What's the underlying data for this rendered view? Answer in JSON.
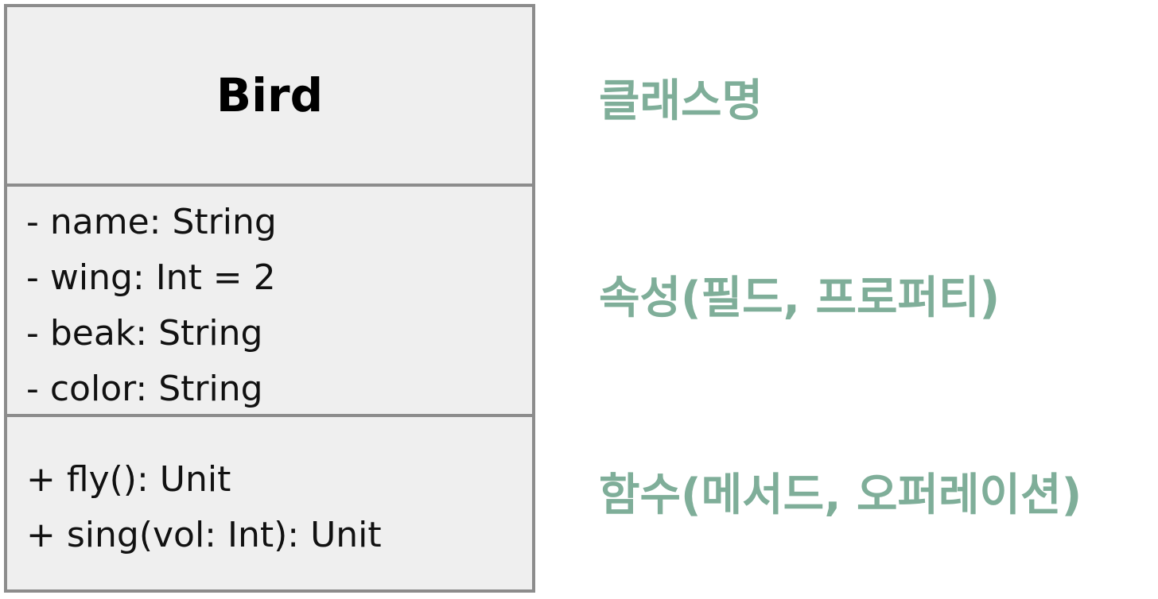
{
  "uml_class": {
    "name": "Bird",
    "attributes": [
      "- name: String",
      "- wing: Int = 2",
      "- beak: String",
      "- color: String"
    ],
    "methods": [
      "+ fly(): Unit",
      "+ sing(vol: Int): Unit"
    ]
  },
  "labels": {
    "class_name": "클래스명",
    "attributes": "속성(필드, 프로퍼티)",
    "methods": "함수(메서드, 오퍼레이션)"
  },
  "colors": {
    "label": "#7fae99",
    "box_border": "#8c8c8c",
    "box_fill": "#efefef"
  }
}
